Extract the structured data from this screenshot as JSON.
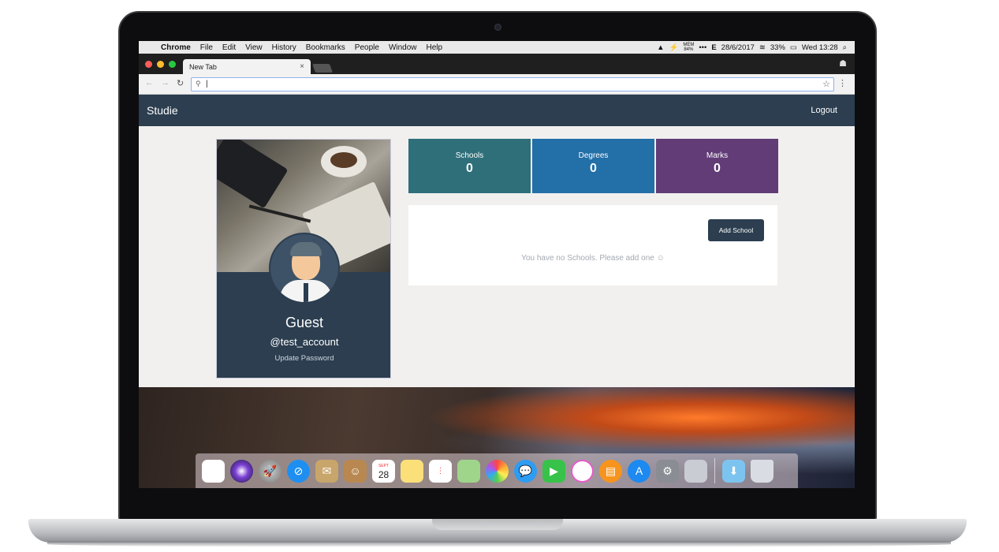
{
  "macos_menubar": {
    "app_name": "Chrome",
    "menus": [
      "File",
      "Edit",
      "View",
      "History",
      "Bookmarks",
      "People",
      "Window",
      "Help"
    ],
    "status": {
      "mem_label": "MEM",
      "mem_value": "84%",
      "input_source": "E",
      "date": "28/6/2017",
      "battery": "33%",
      "clock": "Wed 13:28"
    }
  },
  "browser": {
    "tab_title": "New Tab",
    "tab_close": "×",
    "omnibox_value": "|"
  },
  "app": {
    "brand": "Studie",
    "logout_label": "Logout",
    "profile": {
      "name": "Guest",
      "username": "@test_account",
      "update_password_label": "Update Password"
    },
    "stats": [
      {
        "label": "Schools",
        "value": "0",
        "color": "#2f6f7a"
      },
      {
        "label": "Degrees",
        "value": "0",
        "color": "#236fa8"
      },
      {
        "label": "Marks",
        "value": "0",
        "color": "#613c77"
      }
    ],
    "schools_panel": {
      "add_button_label": "Add School",
      "empty_message": "You have no Schools. Please add one  ☺"
    }
  },
  "colors": {
    "navbar": "#2c3e50",
    "page_bg": "#f1f0ef"
  },
  "dock_icons": [
    "finder-icon",
    "siri-icon",
    "launchpad-icon",
    "safari-icon",
    "mail-icon",
    "contacts-icon",
    "calendar-icon",
    "notes-icon",
    "reminders-icon",
    "maps-icon",
    "photos-icon",
    "messages-icon",
    "facetime-icon",
    "itunes-icon",
    "ibooks-icon",
    "app-store-icon",
    "system-preferences-icon",
    "disk-utility-icon",
    "downloads-folder-icon",
    "trash-icon"
  ],
  "dock": {
    "calendar_month": "SEPT",
    "calendar_day": "28"
  }
}
